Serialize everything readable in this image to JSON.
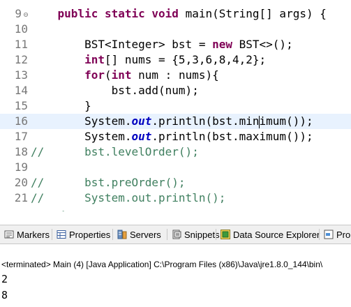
{
  "editor": {
    "lines": [
      {
        "num": "9",
        "html": "    <span class='kw'>public</span> <span class='kw'>static</span> <span class='kw'>void</span> main(String[] args) {"
      },
      {
        "num": "10",
        "html": ""
      },
      {
        "num": "11",
        "html": "        BST&lt;Integer&gt; bst = <span class='kw'>new</span> BST&lt;&gt;();"
      },
      {
        "num": "12",
        "html": "        <span class='kw'>int</span>[] nums = {5,3,6,8,4,2};"
      },
      {
        "num": "13",
        "html": "        <span class='kw'>for</span>(<span class='kw'>int</span> num : nums){"
      },
      {
        "num": "14",
        "html": "            bst.add(num);"
      },
      {
        "num": "15",
        "html": "        }"
      },
      {
        "num": "16",
        "html": "        System.<span class='st'>out</span>.println(bst.min<span class='caret'></span>imum());"
      },
      {
        "num": "17",
        "html": "        System.<span class='st'>out</span>.println(bst.maximum());"
      },
      {
        "num": "18",
        "html": "<span class='cm'>//      bst.levelOrder();</span>"
      },
      {
        "num": "19",
        "html": ""
      },
      {
        "num": "20",
        "html": "<span class='cm'>//      bst.preOrder();</span>"
      },
      {
        "num": "21",
        "html": "<span class='cm'>//      System.out.println();</span>"
      },
      {
        "num": "",
        "html": "<span class='cm'>    &lt;</span>"
      }
    ]
  },
  "views": {
    "tabs": [
      {
        "label": "Markers",
        "icon": "markers-icon"
      },
      {
        "label": "Properties",
        "icon": "properties-icon"
      },
      {
        "label": "Servers",
        "icon": "servers-icon"
      },
      {
        "label": "Snippets",
        "icon": "snippets-icon"
      },
      {
        "label": "Data Source Explorer",
        "icon": "data-source-icon"
      },
      {
        "label": "Pro",
        "icon": "progress-icon"
      }
    ]
  },
  "console": {
    "header": "<terminated> Main (4) [Java Application] C:\\Program Files (x86)\\Java\\jre1.8.0_144\\bin\\",
    "output": [
      "2",
      "8"
    ]
  }
}
